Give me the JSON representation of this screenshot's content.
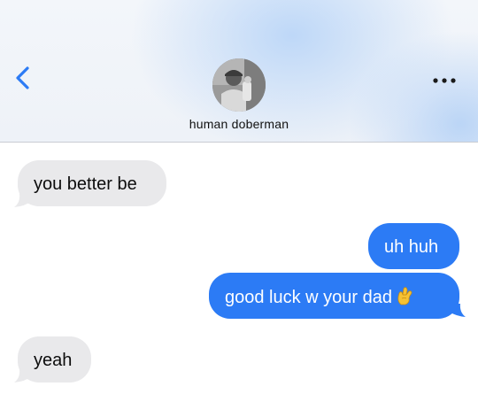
{
  "header": {
    "back_icon": "chevron-left-icon",
    "more_icon": "ellipsis-icon",
    "contact_name": "human doberman",
    "accent_color": "#2c7bf5"
  },
  "messages": [
    {
      "direction": "incoming",
      "text": "you better be"
    },
    {
      "direction": "outgoing",
      "text": "uh huh"
    },
    {
      "direction": "outgoing",
      "text": "good luck w your dad",
      "emoji": "crossed-fingers-icon"
    },
    {
      "direction": "incoming",
      "text": "yeah"
    }
  ]
}
